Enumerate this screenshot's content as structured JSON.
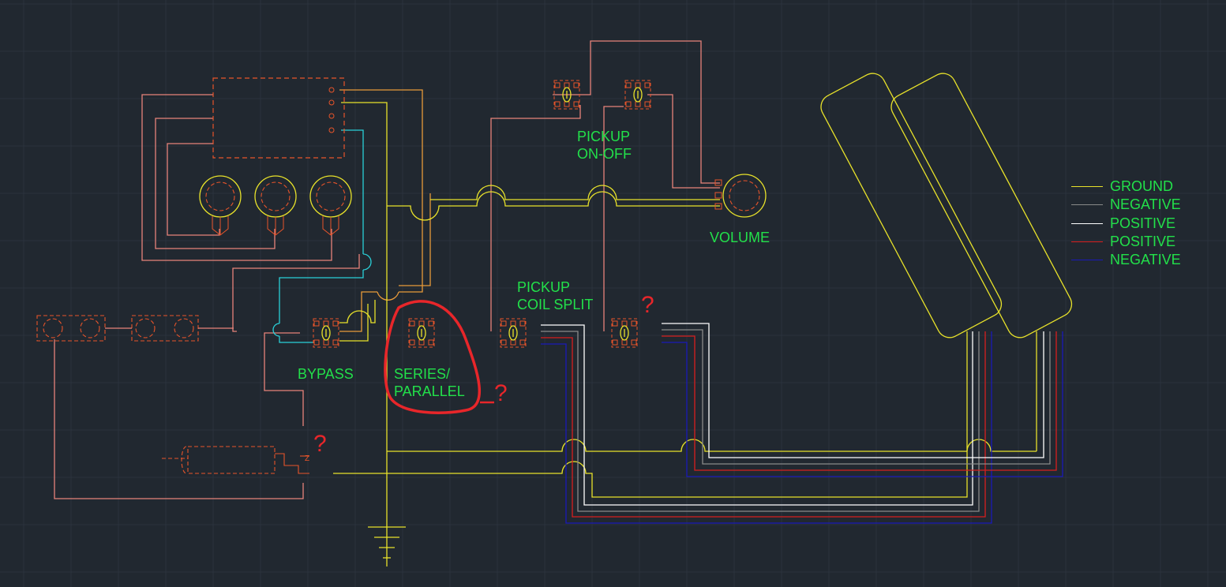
{
  "labels": {
    "pickup_on_off": [
      "PICKUP",
      "ON-OFF"
    ],
    "volume": "VOLUME",
    "pickup_coil_split": [
      "PICKUP",
      "COIL SPLIT"
    ],
    "bypass": "BYPASS",
    "series_parallel": [
      "SERIES/",
      "PARALLEL"
    ]
  },
  "question_mark": "?",
  "legend": [
    {
      "label": "GROUND",
      "color": "#e8e22a"
    },
    {
      "label": "NEGATIVE",
      "color": "#8a8a8a"
    },
    {
      "label": "POSITIVE",
      "color": "#ffffff"
    },
    {
      "label": "POSITIVE",
      "color": "#d81e1e"
    },
    {
      "label": "NEGATIVE",
      "color": "#1a1ab8"
    }
  ],
  "colors": {
    "background": "#212830",
    "grid": "#2c3440",
    "ground": "#e8e22a",
    "wire_salmon": "#e8837a",
    "wire_orange": "#e89a3a",
    "wire_cyan": "#2ad0d8",
    "component": "#e8542a",
    "label": "#22e04a",
    "annotation": "#e8262a"
  }
}
